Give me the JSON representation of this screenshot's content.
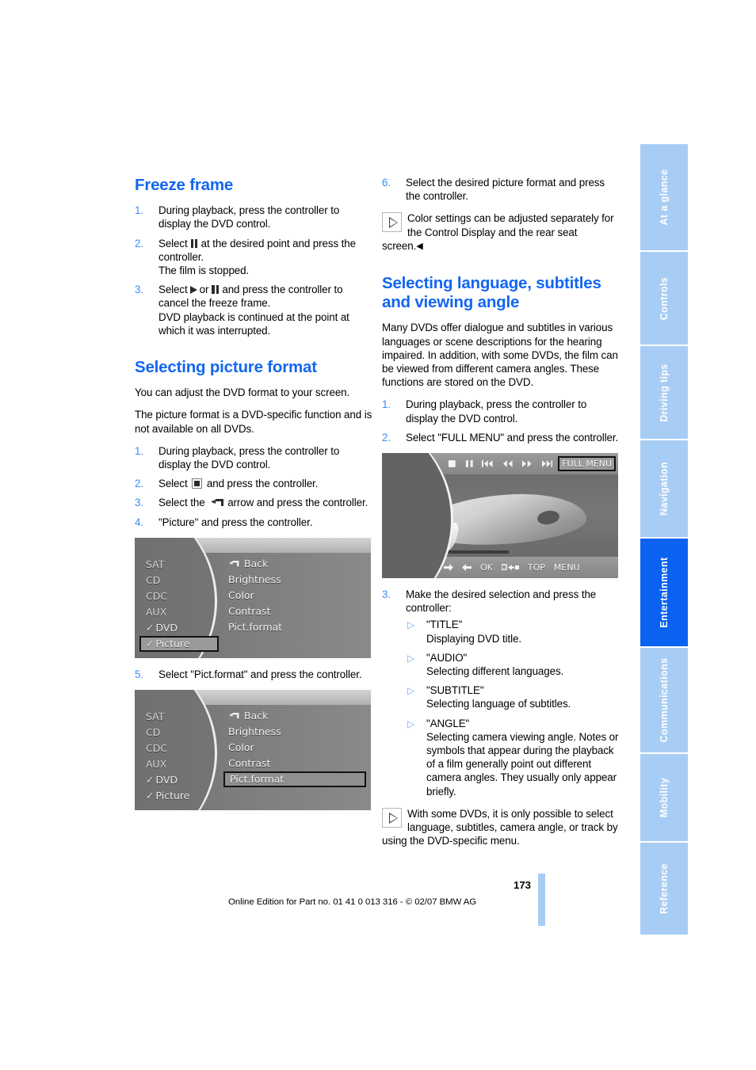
{
  "page": {
    "number": "173",
    "footer": "Online Edition for Part no. 01 41 0 013 316 - © 02/07 BMW AG",
    "accent_blue": "#1266f1",
    "tab_blue": "#a8cdf5",
    "tab_active_blue": "#0a62f0"
  },
  "side_tabs": [
    {
      "label": "At a glance",
      "active": false
    },
    {
      "label": "Controls",
      "active": false
    },
    {
      "label": "Driving tips",
      "active": false
    },
    {
      "label": "Navigation",
      "active": false
    },
    {
      "label": "Entertainment",
      "active": true
    },
    {
      "label": "Communications",
      "active": false
    },
    {
      "label": "Mobility",
      "active": false
    },
    {
      "label": "Reference",
      "active": false
    }
  ],
  "left_column": {
    "freeze_frame": {
      "heading": "Freeze frame",
      "steps": [
        {
          "num": "1.",
          "text": "During playback, press the controller to display the DVD control."
        },
        {
          "num": "2.",
          "pre": "Select",
          "icon": "pause-icon",
          "post": "at the desired point and press the controller.",
          "extra": "The film is stopped."
        },
        {
          "num": "3.",
          "pre": "Select",
          "icon": "play-icon",
          "mid": "or",
          "icon2": "pause-icon",
          "post": "and press the controller to cancel the freeze frame.",
          "extra": "DVD playback is continued at the point at which it was interrupted."
        }
      ]
    },
    "picture_format": {
      "heading": "Selecting picture format",
      "intro1": "You can adjust the DVD format to your screen.",
      "intro2": "The picture format is a DVD-specific function and is not available on all DVDs.",
      "steps": [
        {
          "num": "1.",
          "text": "During playback, press the controller to display the DVD control."
        },
        {
          "num": "2.",
          "pre": "Select",
          "icon": "stop-icon",
          "post": "and press the controller."
        },
        {
          "num": "3.",
          "pre": "Select the",
          "icon": "back-arrow-icon",
          "post": "arrow and press the controller."
        },
        {
          "num": "4.",
          "text": "\"Picture\" and press the controller."
        }
      ],
      "step5": {
        "num": "5.",
        "text": "Select \"Pict.format\" and press the controller."
      }
    },
    "screenshot1": {
      "left_items": [
        {
          "label": "SAT",
          "checked": false,
          "selected": false
        },
        {
          "label": "CD",
          "checked": false,
          "selected": false
        },
        {
          "label": "CDC",
          "checked": false,
          "selected": false
        },
        {
          "label": "AUX",
          "checked": false,
          "selected": false
        },
        {
          "label": "DVD",
          "checked": true,
          "selected": false
        },
        {
          "label": "Picture",
          "checked": true,
          "selected": true
        }
      ],
      "right_items": [
        {
          "label": "Back",
          "icon": "back-arrow-icon",
          "selected": false
        },
        {
          "label": "Brightness",
          "selected": false
        },
        {
          "label": "Color",
          "selected": false
        },
        {
          "label": "Contrast",
          "selected": false
        },
        {
          "label": "Pict.format",
          "selected": false
        }
      ]
    },
    "screenshot2": {
      "left_items": [
        {
          "label": "SAT",
          "checked": false,
          "selected": false
        },
        {
          "label": "CD",
          "checked": false,
          "selected": false
        },
        {
          "label": "CDC",
          "checked": false,
          "selected": false
        },
        {
          "label": "AUX",
          "checked": false,
          "selected": false
        },
        {
          "label": "DVD",
          "checked": true,
          "selected": false
        },
        {
          "label": "Picture",
          "checked": true,
          "selected": false
        }
      ],
      "right_items": [
        {
          "label": "Back",
          "icon": "back-arrow-icon",
          "selected": false
        },
        {
          "label": "Brightness",
          "selected": false
        },
        {
          "label": "Color",
          "selected": false
        },
        {
          "label": "Contrast",
          "selected": false
        },
        {
          "label": "Pict.format",
          "selected": true
        }
      ]
    }
  },
  "right_column": {
    "step6": {
      "num": "6.",
      "text": "Select the desired picture format and press the controller."
    },
    "note1": "Color settings can be adjusted separately for the Control Display and the rear seat screen.",
    "language": {
      "heading": "Selecting language, subtitles and viewing angle",
      "intro": "Many DVDs offer dialogue and subtitles in various languages or scene descriptions for the hearing impaired. In addition, with some DVDs, the film can be viewed from different camera angles. These functions are stored on the DVD.",
      "steps": [
        {
          "num": "1.",
          "text": "During playback, press the controller to display the DVD control."
        },
        {
          "num": "2.",
          "text": "Select \"FULL MENU\" and press the controller."
        }
      ],
      "step3": {
        "num": "3.",
        "text": "Make the desired selection and press the controller:"
      },
      "options": [
        {
          "title": "\"TITLE\"",
          "desc": "Displaying DVD title."
        },
        {
          "title": "\"AUDIO\"",
          "desc": "Selecting different languages."
        },
        {
          "title": "\"SUBTITLE\"",
          "desc": "Selecting language of subtitles."
        },
        {
          "title": "\"ANGLE\"",
          "desc": "Selecting camera viewing angle.\nNotes or symbols that appear during the playback of a film generally point out different camera angles. They usually only appear briefly."
        }
      ],
      "note2": "With some DVDs, it is only possible to select language, subtitles, camera angle, or track by using the DVD-specific menu."
    },
    "dvd_control": {
      "top_buttons": [
        {
          "name": "back-arrow-icon",
          "label": "",
          "selected": false
        },
        {
          "name": "eject-icon",
          "label": "",
          "selected": false
        },
        {
          "name": "stop-icon",
          "label": "",
          "selected": false
        },
        {
          "name": "pause-icon",
          "label": "",
          "selected": false
        },
        {
          "name": "skip-back-icon",
          "label": "",
          "selected": false
        },
        {
          "name": "rewind-icon",
          "label": "",
          "selected": false
        },
        {
          "name": "fast-forward-icon",
          "label": "",
          "selected": false
        },
        {
          "name": "skip-forward-icon",
          "label": "",
          "selected": false
        },
        {
          "name": "full-menu-button",
          "label": "FULL MENU",
          "selected": true
        }
      ],
      "bottom_buttons": [
        {
          "name": "arrow-up-icon",
          "label": "",
          "selected": false
        },
        {
          "name": "arrow-down-icon",
          "label": "",
          "selected": false
        },
        {
          "name": "arrow-right-icon",
          "label": "",
          "selected": false
        },
        {
          "name": "arrow-left-icon",
          "label": "",
          "selected": false
        },
        {
          "name": "ok-button",
          "label": "OK",
          "selected": false
        },
        {
          "name": "return-icon",
          "label": "",
          "selected": false
        },
        {
          "name": "top-button",
          "label": "TOP",
          "selected": false
        },
        {
          "name": "menu-button",
          "label": "MENU",
          "selected": false
        }
      ]
    }
  }
}
